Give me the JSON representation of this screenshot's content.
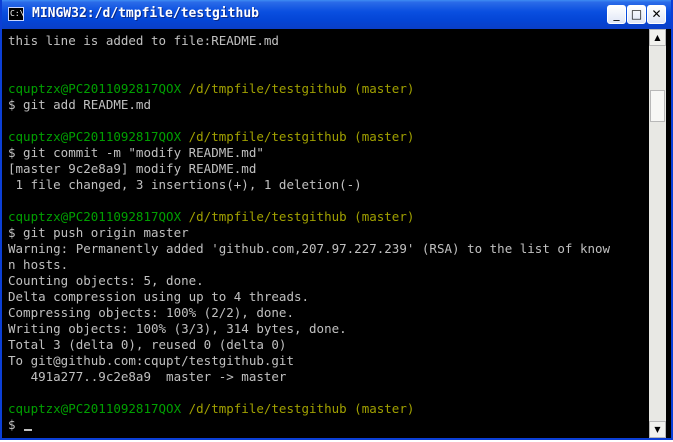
{
  "window": {
    "title": "MINGW32:/d/tmpfile/testgithub",
    "icon_label": "C:\\",
    "buttons": {
      "minimize": "_",
      "maximize": "□",
      "close": "✕"
    }
  },
  "terminal": {
    "colors": {
      "background": "#000000",
      "text": "#c0c0c0",
      "user": "#00a000",
      "path": "#a0a000"
    },
    "lines": [
      {
        "text": "this line is added to file:README.md"
      },
      {
        "text": ""
      },
      {
        "text": ""
      },
      {
        "user": "cquptzx@PC2011092817QOX",
        "path": " /d/tmpfile/testgithub (master)"
      },
      {
        "text": "$ git add README.md"
      },
      {
        "text": ""
      },
      {
        "user": "cquptzx@PC2011092817QOX",
        "path": " /d/tmpfile/testgithub (master)"
      },
      {
        "text": "$ git commit -m \"modify README.md\""
      },
      {
        "text": "[master 9c2e8a9] modify README.md"
      },
      {
        "text": " 1 file changed, 3 insertions(+), 1 deletion(-)"
      },
      {
        "text": ""
      },
      {
        "user": "cquptzx@PC2011092817QOX",
        "path": " /d/tmpfile/testgithub (master)"
      },
      {
        "text": "$ git push origin master"
      },
      {
        "text": "Warning: Permanently added 'github.com,207.97.227.239' (RSA) to the list of know"
      },
      {
        "text": "n hosts."
      },
      {
        "text": "Counting objects: 5, done."
      },
      {
        "text": "Delta compression using up to 4 threads."
      },
      {
        "text": "Compressing objects: 100% (2/2), done."
      },
      {
        "text": "Writing objects: 100% (3/3), 314 bytes, done."
      },
      {
        "text": "Total 3 (delta 0), reused 0 (delta 0)"
      },
      {
        "text": "To git@github.com:cqupt/testgithub.git"
      },
      {
        "text": "   491a277..9c2e8a9  master -> master"
      },
      {
        "text": ""
      },
      {
        "user": "cquptzx@PC2011092817QOX",
        "path": " /d/tmpfile/testgithub (master)"
      }
    ],
    "prompt": "$ "
  },
  "scrollbar": {
    "up_arrow": "▲",
    "down_arrow": "▼",
    "position": 0.85
  }
}
